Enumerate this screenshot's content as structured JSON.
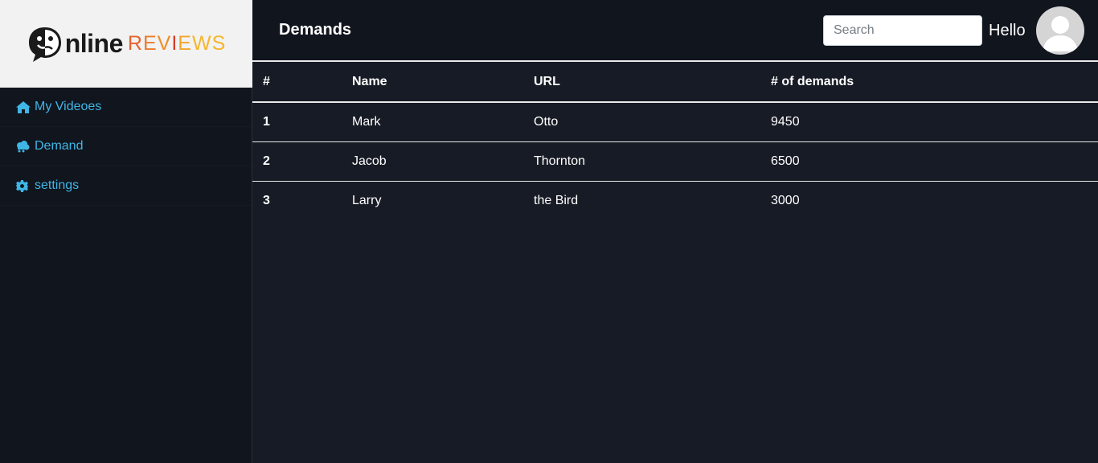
{
  "brand": {
    "logo_text_main": "nline",
    "logo_text_reviews": [
      "R",
      "E",
      "V",
      "I",
      "E",
      "W",
      "S"
    ]
  },
  "sidebar": {
    "items": [
      {
        "label": "My Videoes",
        "icon": "home-icon"
      },
      {
        "label": "Demand",
        "icon": "cloud-icon"
      },
      {
        "label": "settings",
        "icon": "gear-icon"
      }
    ]
  },
  "header": {
    "title": "Demands",
    "search_placeholder": "Search",
    "greeting": "Hello"
  },
  "table": {
    "columns": [
      "#",
      "Name",
      "URL",
      "# of demands"
    ],
    "rows": [
      {
        "num": "1",
        "name": "Mark",
        "url": "Otto",
        "demands": "9450"
      },
      {
        "num": "2",
        "name": "Jacob",
        "url": "Thornton",
        "demands": "6500"
      },
      {
        "num": "3",
        "name": "Larry",
        "url": "the Bird",
        "demands": "3000"
      }
    ]
  },
  "colors": {
    "sidebar_bg": "#11151e",
    "main_bg": "#171b25",
    "accent_link": "#3fb6e6"
  }
}
